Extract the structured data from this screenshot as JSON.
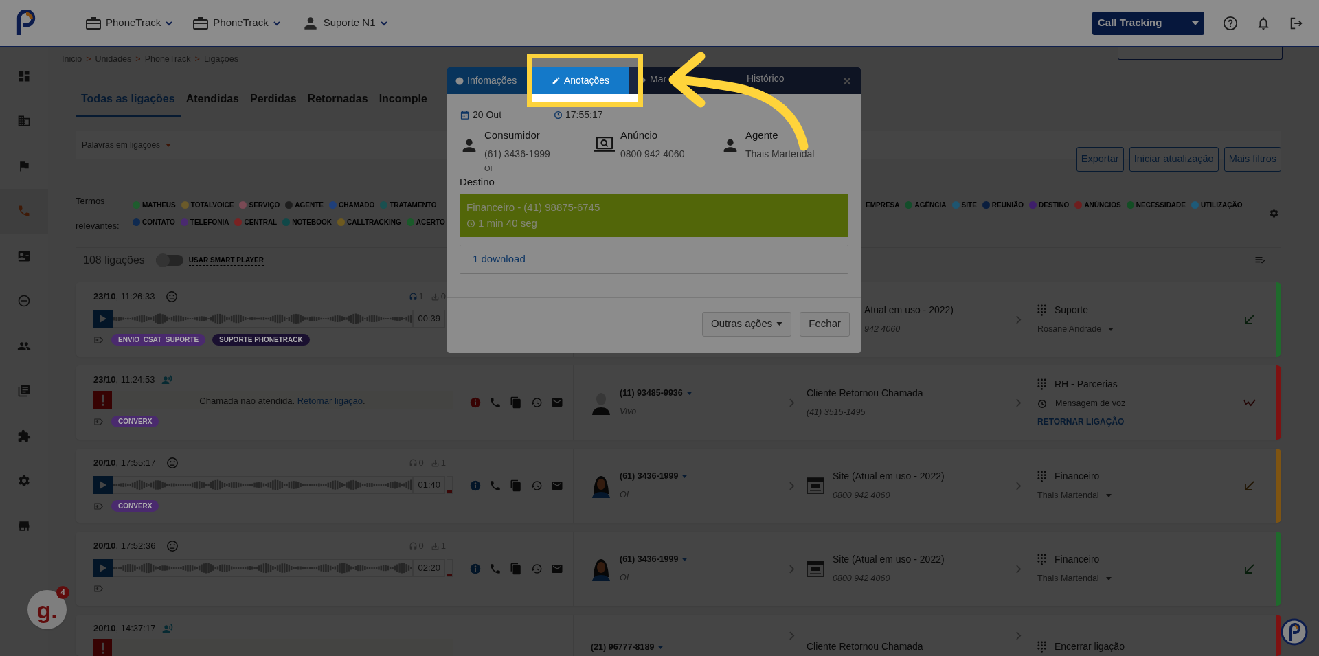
{
  "header": {
    "units": [
      {
        "label": "PhoneTrack"
      },
      {
        "label": "PhoneTrack"
      }
    ],
    "user": "Suporte N1",
    "product": "Call Tracking"
  },
  "sidebar": {
    "items": [
      {
        "kind": "dashboard",
        "selected": false
      },
      {
        "kind": "building",
        "selected": false
      },
      {
        "kind": "flag",
        "selected": false
      },
      {
        "kind": "phone",
        "selected": true
      },
      {
        "kind": "contact",
        "selected": false
      },
      {
        "kind": "gauge",
        "selected": false
      },
      {
        "kind": "people",
        "selected": false
      },
      {
        "kind": "library",
        "selected": false
      },
      {
        "kind": "puzzle",
        "selected": false
      },
      {
        "kind": "gear",
        "selected": false
      },
      {
        "kind": "store",
        "selected": false
      }
    ]
  },
  "breadcrumb": {
    "separator": ">",
    "items": [
      "Inicio",
      "Unidades",
      "PhoneTrack",
      "Ligações"
    ]
  },
  "tabs": [
    {
      "label": "Todas as ligações",
      "selected": true
    },
    {
      "label": "Atendidas",
      "selected": false
    },
    {
      "label": "Perdidas",
      "selected": false
    },
    {
      "label": "Retornadas",
      "selected": false
    },
    {
      "label": "Incomple",
      "selected": false
    }
  ],
  "filter": {
    "dropdown": "Palavras em ligações",
    "buttons": [
      "Exportar",
      "Iniciar atualização",
      "Mais filtros"
    ]
  },
  "terms": {
    "label_1": "Termos",
    "label_2": "relevantes:",
    "line_1_left": [
      {
        "label": "MATHEUS",
        "color": "#1f5c2e"
      },
      {
        "label": "TOTALVOICE",
        "color": "#6b5a2a"
      },
      {
        "label": "SERVIÇO",
        "color": "#7a4a55"
      },
      {
        "label": "AGENTE",
        "color": "#1e1e1e"
      },
      {
        "label": "CHAMADO",
        "color": "#1f3f7a"
      },
      {
        "label": "TRATAMENTO",
        "color": "#1a5050"
      }
    ],
    "line_1_right": [
      {
        "label": "EMPRESA"
      },
      {
        "label": "AGÊNCIA",
        "color": "#134d2a"
      },
      {
        "label": "SITE",
        "color": "#1e5570"
      },
      {
        "label": "REUNIÃO",
        "color": "#0a1e3e"
      },
      {
        "label": "DESTINO",
        "color": "#3e1e6a"
      },
      {
        "label": "ANÚNCIOS",
        "color": "#6e1e1e"
      },
      {
        "label": "NECESSIDADE",
        "color": "#134d24"
      },
      {
        "label": "UTILIZAÇÃO",
        "color": "#1e5a78"
      }
    ],
    "line_2": [
      {
        "label": "CONTATO",
        "color": "#0f2a50"
      },
      {
        "label": "TELEFONIA",
        "color": "#4a2a70"
      },
      {
        "label": "CENTRAL",
        "color": "#7a2222"
      },
      {
        "label": "NOTEBOOK",
        "color": "#104848"
      },
      {
        "label": "CALLTRACKING",
        "color": "#6e5a20"
      },
      {
        "label": "ACERTO",
        "color": "#1a5a2a"
      }
    ]
  },
  "list": {
    "count": "108 ligações",
    "smart_player": {
      "label": "USAR SMART PLAYER",
      "on": false
    }
  },
  "calls": [
    {
      "kind": "recorded",
      "covered": true,
      "datetime": "**23/10**, 11:26:33",
      "listens": "1",
      "downloads": "0",
      "duration": "00:39",
      "tags": [
        {
          "label": "ENVIO_CSAT_SUPORTE",
          "color": "#4a2a6e"
        },
        {
          "label": "SUPORTE PHONETRACK",
          "color": "#1a1030"
        }
      ],
      "dest": {
        "kind": "site",
        "name": "Atual em uso - 2022)",
        "number": "942 4060"
      },
      "team": {
        "name": "Suporte",
        "agent": "Rosane Andrade"
      },
      "color": "#1f6a2c"
    },
    {
      "kind": "missed",
      "datetime": "**23/10**, 11:24:53",
      "message": "Chamada não atendida.",
      "link": "Retornar ligação",
      "message_end": ".",
      "tags": [
        {
          "label": "CONVERX",
          "color": "#4a2a6e"
        }
      ],
      "caller": {
        "number": "(11) 93485-9936",
        "carrier": "Vivo",
        "kind": "generic"
      },
      "dest": {
        "kind": "return",
        "name": "Cliente Retornou Chamada",
        "number": "(41) 3515-1495"
      },
      "team": {
        "name": "RH - Parcerias",
        "status": "Mensagem de voz",
        "action": "RETORNAR LIGAÇÃO"
      },
      "color": "#7e1212"
    },
    {
      "kind": "recorded",
      "datetime": "**20/10**, 17:55:17",
      "listens": "0",
      "downloads": "1",
      "duration": "01:40",
      "tags": [
        {
          "label": "CONVERX",
          "color": "#4a2a6e"
        }
      ],
      "caller": {
        "number": "(61) 3436-1999",
        "carrier": "OI",
        "kind": "female"
      },
      "dest": {
        "kind": "site",
        "name": "Site (Atual em uso - 2022)",
        "number": "0800 942 4060"
      },
      "team": {
        "name": "Financeiro",
        "agent": "Thais Martendal"
      },
      "color": "#7e5412"
    },
    {
      "kind": "recorded",
      "datetime": "**20/10**, 17:52:36",
      "listens": "0",
      "downloads": "1",
      "duration": "02:20",
      "caller": {
        "number": "(61) 3436-1999",
        "carrier": "OI",
        "kind": "female"
      },
      "dest": {
        "kind": "site",
        "name": "Site (Atual em uso - 2022)",
        "number": "0800 942 4060"
      },
      "team": {
        "name": "Financeiro",
        "agent": "Thais Martendal"
      },
      "color": "#1f6a2c"
    },
    {
      "kind": "missed",
      "cut": true,
      "datetime": "**20/10**, 14:37:17",
      "caller": {
        "number": "(21) 96777-8189"
      },
      "dest": {
        "kind": "return",
        "name": "Cliente Retornou Chamada"
      },
      "team": {
        "name": "Encerrar ligação"
      },
      "color": "#7e1212"
    }
  ],
  "modal": {
    "tabs": [
      {
        "label": "Infomações",
        "selected": false
      },
      {
        "label": "Anotações",
        "selected": true
      },
      {
        "label": "Mar",
        "selected": false
      },
      {
        "label": "Histórico",
        "selected": false
      }
    ],
    "close": "×",
    "date": "20 Out",
    "time": "17:55:17",
    "parties": [
      {
        "kind": "consumer",
        "title": "Consumidor",
        "value": "(61) 3436-1999",
        "note": "OI"
      },
      {
        "kind": "ad",
        "title": "Anúncio",
        "value": "0800 942 4060"
      },
      {
        "kind": "agent",
        "title": "Agente",
        "value": "Thais Martendal"
      }
    ],
    "destination_label": "Destino",
    "destination": {
      "name": "Financeiro - (41) 98875-6745",
      "duration": "1 min 40 seg"
    },
    "download": "1 download",
    "buttons": [
      {
        "label": "Outras ações",
        "kind": "menu"
      },
      {
        "label": "Fechar",
        "kind": "plain"
      }
    ]
  },
  "widget": {
    "label": "g.",
    "badge": "4"
  }
}
